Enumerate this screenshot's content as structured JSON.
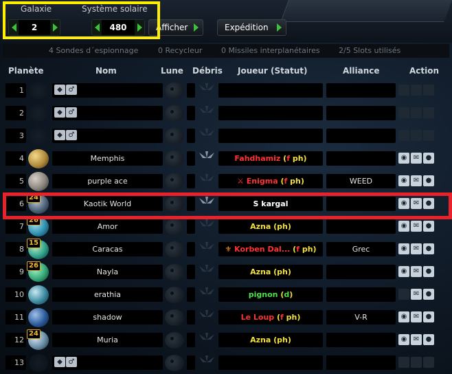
{
  "nav": {
    "galaxy_label": "Galaxie",
    "galaxy_value": "2",
    "system_label": "Système solaire",
    "system_value": "480",
    "show_button": "Afficher",
    "expedition_button": "Expédition"
  },
  "info": {
    "probes": "4 Sondes d´espionnage",
    "recyclers": "0 Recycleur",
    "missiles": "0 Missiles interplanétaires",
    "slots": "2/5 Slots utilisés"
  },
  "columns": {
    "planet": "Planète",
    "name": "Nom",
    "moon": "Lune",
    "debris": "Débris",
    "player": "Joueur (Statut)",
    "alliance": "Alliance",
    "action": "Action"
  },
  "colors": {
    "highlight_yellow": "#ffee00",
    "highlight_red": "#e8212a",
    "player_red": "#ff3333",
    "player_yellow": "#f3e23c",
    "player_green": "#4ee04e"
  },
  "rows": [
    {
      "pos": "1",
      "name": "",
      "player": "",
      "status": "",
      "alliance": "",
      "badge": ""
    },
    {
      "pos": "2",
      "name": "",
      "player": "",
      "status": "",
      "alliance": "",
      "badge": ""
    },
    {
      "pos": "3",
      "name": "",
      "player": "",
      "status": "",
      "alliance": "",
      "badge": ""
    },
    {
      "pos": "4",
      "name": "Memphis",
      "player": "Fahdhamiz",
      "status": "f ph",
      "alliance": "",
      "badge": ""
    },
    {
      "pos": "5",
      "name": "purple ace",
      "player": "Enigma",
      "status": "f ph",
      "alliance": "WEED",
      "badge": ""
    },
    {
      "pos": "6",
      "name": "Kaotik World",
      "player": "S kargal",
      "status": "",
      "alliance": "",
      "badge": "24"
    },
    {
      "pos": "7",
      "name": "Amor",
      "player": "Azna",
      "status": "ph",
      "alliance": "",
      "badge": "26"
    },
    {
      "pos": "8",
      "name": "Caracas",
      "player": "Korben Dal...",
      "status": "f ph",
      "alliance": "Grec",
      "badge": "15"
    },
    {
      "pos": "9",
      "name": "Nayla",
      "player": "Azna",
      "status": "ph",
      "alliance": "",
      "badge": "26"
    },
    {
      "pos": "10",
      "name": "erathia",
      "player": "pignon",
      "status": "d",
      "alliance": "",
      "badge": ""
    },
    {
      "pos": "11",
      "name": "shadow",
      "player": "Le Loup",
      "status": "f ph",
      "alliance": "V-R",
      "badge": ""
    },
    {
      "pos": "12",
      "name": "Muria",
      "player": "Azna",
      "status": "ph",
      "alliance": "",
      "badge": "24"
    },
    {
      "pos": "13",
      "name": "",
      "player": "",
      "status": "",
      "alliance": "",
      "badge": ""
    }
  ]
}
